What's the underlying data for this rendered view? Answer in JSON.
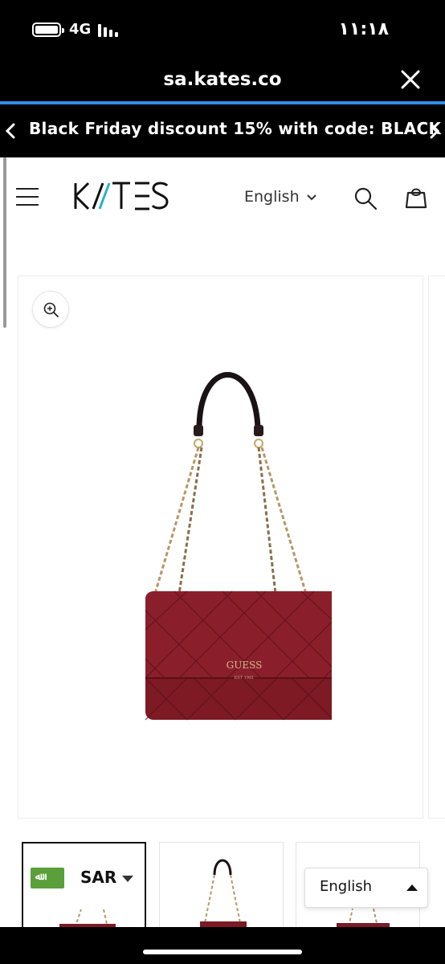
{
  "status_bar": {
    "network": "4G",
    "time": "١١:١٨",
    "battery_level": 1.0,
    "signal_bars": 4
  },
  "browser": {
    "url": "sa.kates.co",
    "close_icon": "close-icon",
    "progress_color": "#2f8ee8"
  },
  "announcement": {
    "text": "Black Friday discount 15% with code: BLACK",
    "prev_icon": "chevron-left-icon",
    "next_icon": "chevron-right-icon"
  },
  "header": {
    "logo_text": "KATES",
    "language": "English",
    "menu_icon": "hamburger-icon",
    "search_icon": "search-icon",
    "cart_icon": "cart-icon"
  },
  "product": {
    "brand_on_bag": "GUESS",
    "brand_sub": "EST 1981",
    "bag_color": "#7d1a24",
    "zoom_icon": "zoom-in-icon"
  },
  "currency": {
    "code": "SAR",
    "flag_icon": "saudi-flag-icon"
  },
  "language_popup": {
    "label": "English"
  }
}
